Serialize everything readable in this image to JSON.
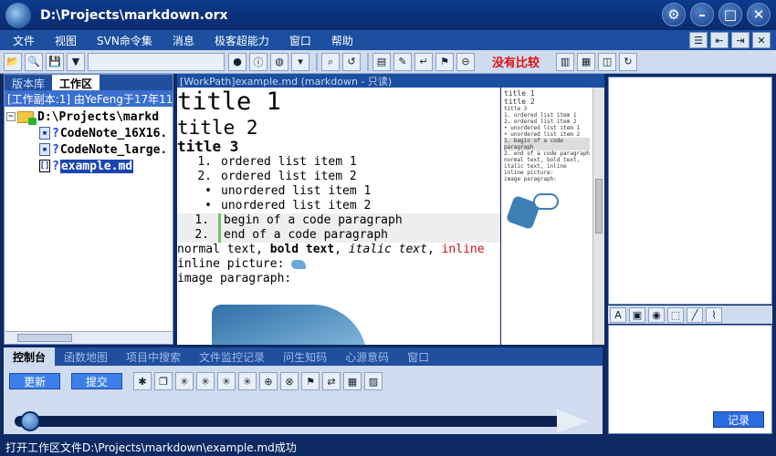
{
  "window": {
    "title": "D:\\Projects\\markdown.orx"
  },
  "menu": {
    "items": [
      "文件",
      "视图",
      "SVN命令集",
      "消息",
      "极客超能力",
      "窗口",
      "帮助"
    ]
  },
  "toolbar": {
    "no_compare": "没有比较"
  },
  "left_panel": {
    "tabs": [
      "版本库",
      "工作区"
    ],
    "workcopy_label": "[工作副本:1] 由YeFeng于17年11...",
    "tree": {
      "root": "D:\\Projects\\markd",
      "files": [
        "CodeNote_16X16.",
        "CodeNote_large.",
        "example.md"
      ]
    }
  },
  "editor": {
    "header": "[WorkPath]example.md (markdown - 只读)",
    "h1": "title 1",
    "h2": "title 2",
    "h3": "title 3",
    "ordered": [
      {
        "mk": "1.",
        "text": "ordered list item 1"
      },
      {
        "mk": "2.",
        "text": "ordered list item 2"
      }
    ],
    "unordered": [
      {
        "mk": "•",
        "text": "unordered list item 1"
      },
      {
        "mk": "•",
        "text": "unordered list item 2"
      }
    ],
    "code": [
      {
        "mk": "1.",
        "text": "begin of a code paragraph"
      },
      {
        "mk": "2.",
        "text": "end of a code paragraph"
      }
    ],
    "normal_text": "normal text, ",
    "bold_text": "bold text",
    "italic_text": "italic text",
    "inline_text": "inline",
    "inline_picture": "inline picture:",
    "image_paragraph": "image paragraph:"
  },
  "preview": {
    "lines": [
      "title 1",
      "title 2",
      "title 3",
      "1. ordered list item 1",
      "2. ordered list item 2",
      "• unordered list item 1",
      "• unordered list item 2",
      "1. begin of a code paragraph",
      "2. end of a code paragraph",
      "normal text, bold text, italic text, inline",
      "inline picture:",
      "image paragraph:"
    ]
  },
  "bottom_panel": {
    "tabs": [
      "控制台",
      "函数地图",
      "项目中搜索",
      "文件监控记录",
      "问生知码",
      "心源意码",
      "窗口"
    ],
    "update_button": "更新",
    "commit_button": "提交"
  },
  "right_panel": {
    "record_button": "记录"
  },
  "status": {
    "text": "打开工作区文件D:\\Projects\\markdown\\example.md成功"
  }
}
